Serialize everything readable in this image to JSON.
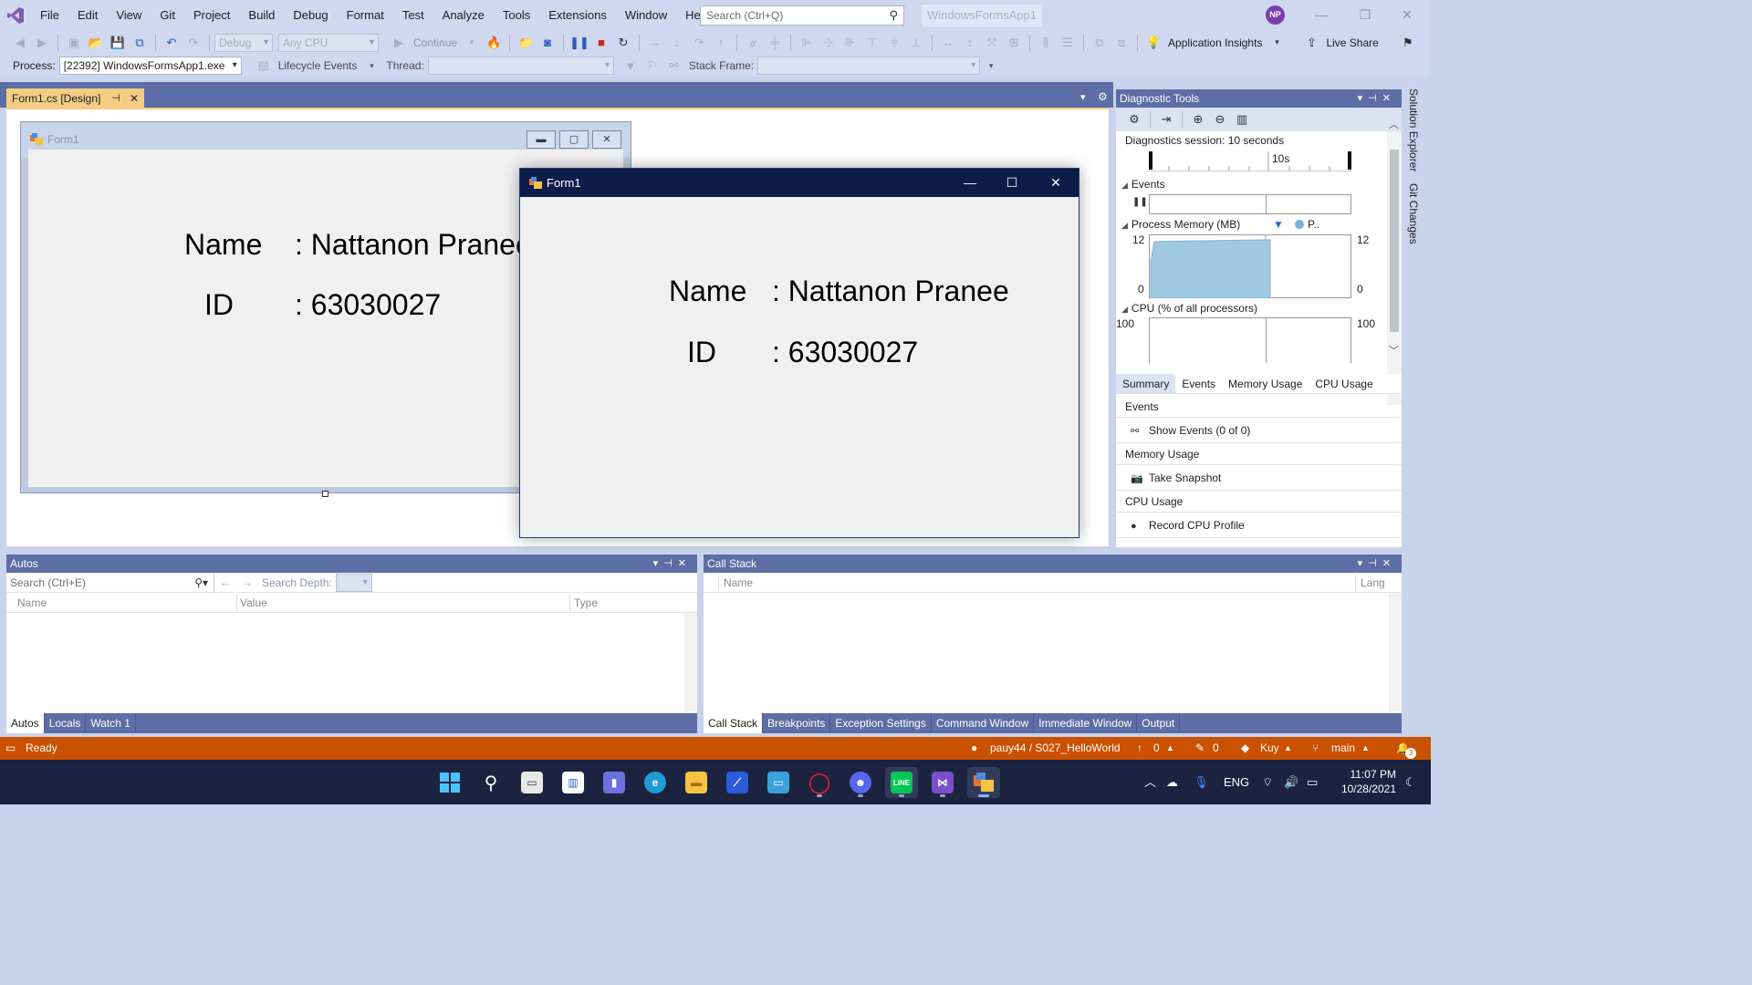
{
  "menubar": {
    "items": [
      "File",
      "Edit",
      "View",
      "Git",
      "Project",
      "Build",
      "Debug",
      "Format",
      "Test",
      "Analyze",
      "Tools",
      "Extensions",
      "Window",
      "Help"
    ],
    "search_placeholder": "Search (Ctrl+Q)",
    "solution_name": "WindowsFormsApp1",
    "avatar_initials": "NP"
  },
  "toolbar": {
    "config": "Debug",
    "platform": "Any CPU",
    "continue_label": "Continue",
    "app_insights_label": "Application Insights",
    "live_share_label": "Live Share"
  },
  "debug_location": {
    "process_label": "Process:",
    "process_value": "[22392] WindowsFormsApp1.exe",
    "lifecycle_label": "Lifecycle Events",
    "thread_label": "Thread:",
    "stack_frame_label": "Stack Frame:"
  },
  "document": {
    "tab_title": "Form1.cs [Design]"
  },
  "designer_form": {
    "title": "Form1",
    "name_label": "Name",
    "name_value": ": Nattanon Pranee",
    "id_label": "ID",
    "id_value": ": 63030027"
  },
  "running_form": {
    "title": "Form1",
    "name_label": "Name",
    "name_value": ": Nattanon Pranee",
    "id_label": "ID",
    "id_value": ": 63030027"
  },
  "diagnostics": {
    "title": "Diagnostic Tools",
    "session_text": "Diagnostics session: 10 seconds",
    "timeline_label": "10s",
    "events_header": "Events",
    "memory_header": "Process Memory (MB)",
    "memory_legend": "P..",
    "memory_max": "12",
    "memory_min": "0",
    "memory_max_right": "12",
    "memory_min_right": "0",
    "cpu_header": "CPU (% of all processors)",
    "cpu_max": "100",
    "cpu_max_right": "100",
    "tabs": [
      "Summary",
      "Events",
      "Memory Usage",
      "CPU Usage"
    ],
    "group_events": "Events",
    "show_events": "Show Events (0 of 0)",
    "group_memory": "Memory Usage",
    "take_snapshot": "Take Snapshot",
    "group_cpu": "CPU Usage",
    "record_cpu": "Record CPU Profile"
  },
  "side_tabs": {
    "solution_explorer": "Solution Explorer",
    "git_changes": "Git Changes"
  },
  "autos": {
    "title": "Autos",
    "search_placeholder": "Search (Ctrl+E)",
    "search_depth_label": "Search Depth:",
    "col_name": "Name",
    "col_value": "Value",
    "col_type": "Type",
    "tabs": [
      "Autos",
      "Locals",
      "Watch 1"
    ]
  },
  "callstack": {
    "title": "Call Stack",
    "col_name": "Name",
    "col_lang": "Lang",
    "tabs": [
      "Call Stack",
      "Breakpoints",
      "Exception Settings",
      "Command Window",
      "Immediate Window",
      "Output"
    ]
  },
  "statusbar": {
    "ready": "Ready",
    "repo": "pauy44 / S027_HelloWorld",
    "push_count": "0",
    "pending_count": "0",
    "user_branch": "Kuy",
    "branch": "main",
    "notifications": "3"
  },
  "taskbar": {
    "language": "ENG",
    "time": "11:07 PM",
    "date": "10/28/2021"
  },
  "colors": {
    "vs_chrome": "#cfd8ee",
    "pane_title": "#5d6ea6",
    "active_tab": "#f5cc84",
    "status_debug": "#ca5100",
    "taskbar": "#1c2340"
  },
  "chart_memory": {
    "type": "area",
    "ylim": [
      0,
      12
    ],
    "fill_fraction_x": 0.6,
    "level": 11
  }
}
